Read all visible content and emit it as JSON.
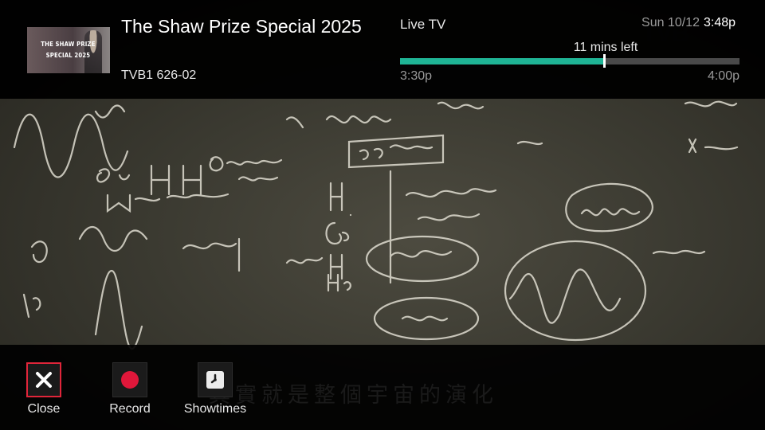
{
  "program": {
    "title": "The Shaw Prize Special 2025",
    "channel": "TVB1 626-02",
    "thumbnail_text_line1": "THE SHAW PRIZE",
    "thumbnail_text_line2": "SPECIAL 2025"
  },
  "status": {
    "source": "Live TV",
    "date": "Sun 10/12",
    "time": "3:48p"
  },
  "progress": {
    "remaining_label": "11 mins left",
    "start": "3:30p",
    "end": "4:00p",
    "fraction_elapsed": 0.6,
    "accent_color": "#1fb495"
  },
  "subtitle": "其實就是整個宇宙的演化",
  "actions": [
    {
      "label": "Close",
      "icon": "close-icon",
      "focused": true
    },
    {
      "label": "Record",
      "icon": "record-icon",
      "focused": false
    },
    {
      "label": "Showtimes",
      "icon": "clock-icon",
      "focused": false
    }
  ],
  "colors": {
    "focus_border": "#e0253a",
    "record_red": "#e0173a"
  }
}
